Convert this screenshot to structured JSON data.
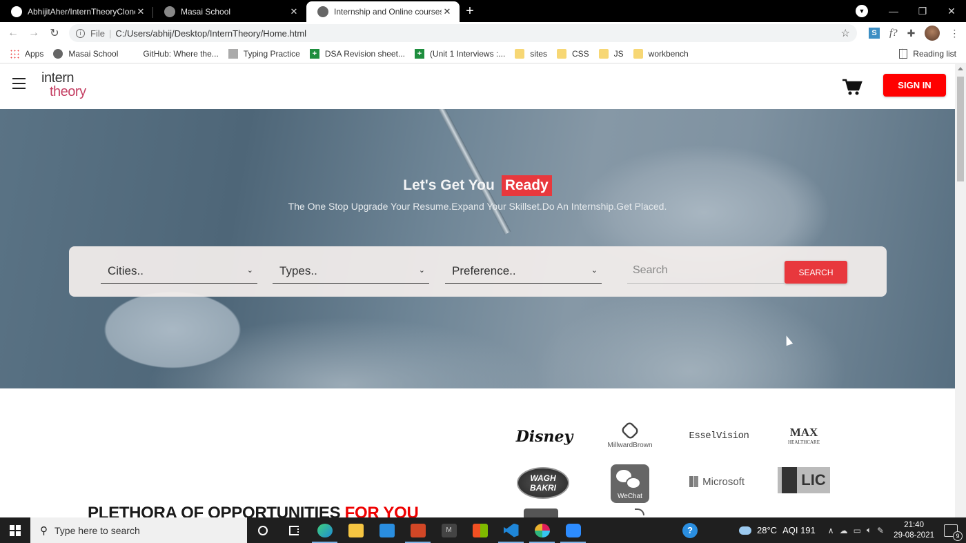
{
  "browser": {
    "tabs": [
      {
        "title": "AbhijitAher/InternTheoryClone",
        "icon": "github-icon",
        "active": false
      },
      {
        "title": "Masai School",
        "icon": "globe-icon",
        "active": false
      },
      {
        "title": "Internship and Online courses for",
        "icon": "globe-icon",
        "active": true
      }
    ],
    "new_tab": "+",
    "address": {
      "scheme_label": "File",
      "url": "C:/Users/abhij/Desktop/InternTheory/Home.html"
    },
    "extensions": [
      "S",
      "f?"
    ],
    "bookmarks": [
      {
        "label": "Apps",
        "icon": "apps-icon"
      },
      {
        "label": "Masai School",
        "icon": "globe-icon"
      },
      {
        "label": "GitHub: Where the...",
        "icon": "none"
      },
      {
        "label": "Typing Practice",
        "icon": "typing-icon"
      },
      {
        "label": "DSA Revision sheet...",
        "icon": "sheets-icon"
      },
      {
        "label": "(Unit 1 Interviews :...",
        "icon": "sheets-icon"
      },
      {
        "label": "sites",
        "icon": "folder-icon"
      },
      {
        "label": "CSS",
        "icon": "folder-icon"
      },
      {
        "label": "JS",
        "icon": "folder-icon"
      },
      {
        "label": "workbench",
        "icon": "folder-icon"
      }
    ],
    "reading_list": "Reading list"
  },
  "site": {
    "logo": {
      "line1": "intern",
      "line2": "theory"
    },
    "signin_label": "SIGN IN",
    "hero": {
      "title": "Let's Get You",
      "title_highlight": "Ready",
      "subtitle": "The One Stop Upgrade Your Resume.Expand Your Skillset.Do An Internship.Get Placed."
    },
    "search": {
      "cities_placeholder": "Cities..",
      "types_placeholder": "Types..",
      "preference_placeholder": "Preference..",
      "search_placeholder": "Search",
      "button_label": "SEARCH"
    },
    "section_heading": {
      "main": "PLETHORA OF OPPORTUNITIES",
      "accent": "FOR YOU"
    },
    "partner_logos": [
      {
        "name": "Disney",
        "text": "Disney"
      },
      {
        "name": "MillwardBrown",
        "text": "MillwardBrown"
      },
      {
        "name": "EsselVision",
        "text": "EsselVision"
      },
      {
        "name": "MAX Healthcare",
        "text": "MAX",
        "sub": "HEALTHCARE"
      },
      {
        "name": "Wagh Bakri",
        "text": "WAGH BAKRI"
      },
      {
        "name": "WeChat",
        "text": "WeChat"
      },
      {
        "name": "Microsoft",
        "text": "Microsoft"
      },
      {
        "name": "LIC",
        "text": "LIC"
      }
    ],
    "colors": {
      "accent": "#ff0000",
      "highlight": "#e8383d"
    }
  },
  "taskbar": {
    "search_placeholder": "Type here to search",
    "weather": "28°C",
    "aqi": "AQI 191",
    "time": "21:40",
    "date": "29-08-2021",
    "notification_count": "9"
  }
}
